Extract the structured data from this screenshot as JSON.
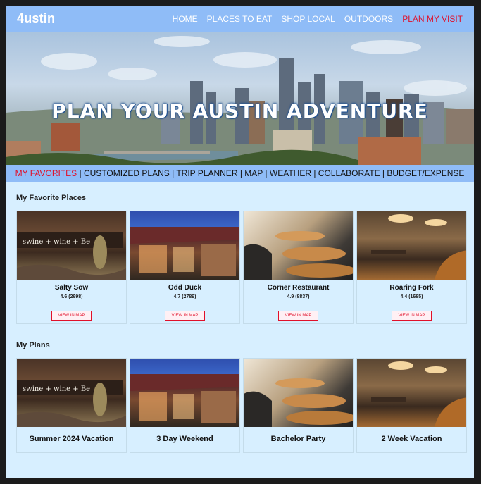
{
  "nav": {
    "brand": "4ustin",
    "links": [
      "HOME",
      "PLACES TO EAT",
      "SHOP LOCAL",
      "OUTDOORS",
      "PLAN MY VISIT"
    ]
  },
  "hero": {
    "title": "PLAN YOUR AUSTIN ADVENTURE"
  },
  "subnav": {
    "items": [
      "MY FAVORITES",
      "CUSTOMIZED PLANS",
      "TRIP PLANNER",
      "MAP",
      "WEATHER",
      "COLLABORATE",
      "BUDGET/EXPENSE"
    ],
    "separator": " | "
  },
  "favorites": {
    "title": "My Favorite Places",
    "button_label": "VIEW IN MAP",
    "places": [
      {
        "name": "Salty Sow",
        "rating": "4.6 (2698)",
        "sign_text": "swine + wine + Be"
      },
      {
        "name": "Odd Duck",
        "rating": "4.7 (2789)"
      },
      {
        "name": "Corner Restaurant",
        "rating": "4.9 (8837)"
      },
      {
        "name": "Roaring Fork",
        "rating": "4.4 (1685)"
      }
    ]
  },
  "plans": {
    "title": "My Plans",
    "items": [
      {
        "name": "Summer 2024 Vacation",
        "sign_text": "swine + wine + Be"
      },
      {
        "name": "3 Day Weekend"
      },
      {
        "name": "Bachelor Party"
      },
      {
        "name": "2 Week Vacation"
      }
    ]
  },
  "colors": {
    "nav_bg": "#8fbcf7",
    "page_bg": "#d7efff",
    "accent": "#e0102a"
  }
}
